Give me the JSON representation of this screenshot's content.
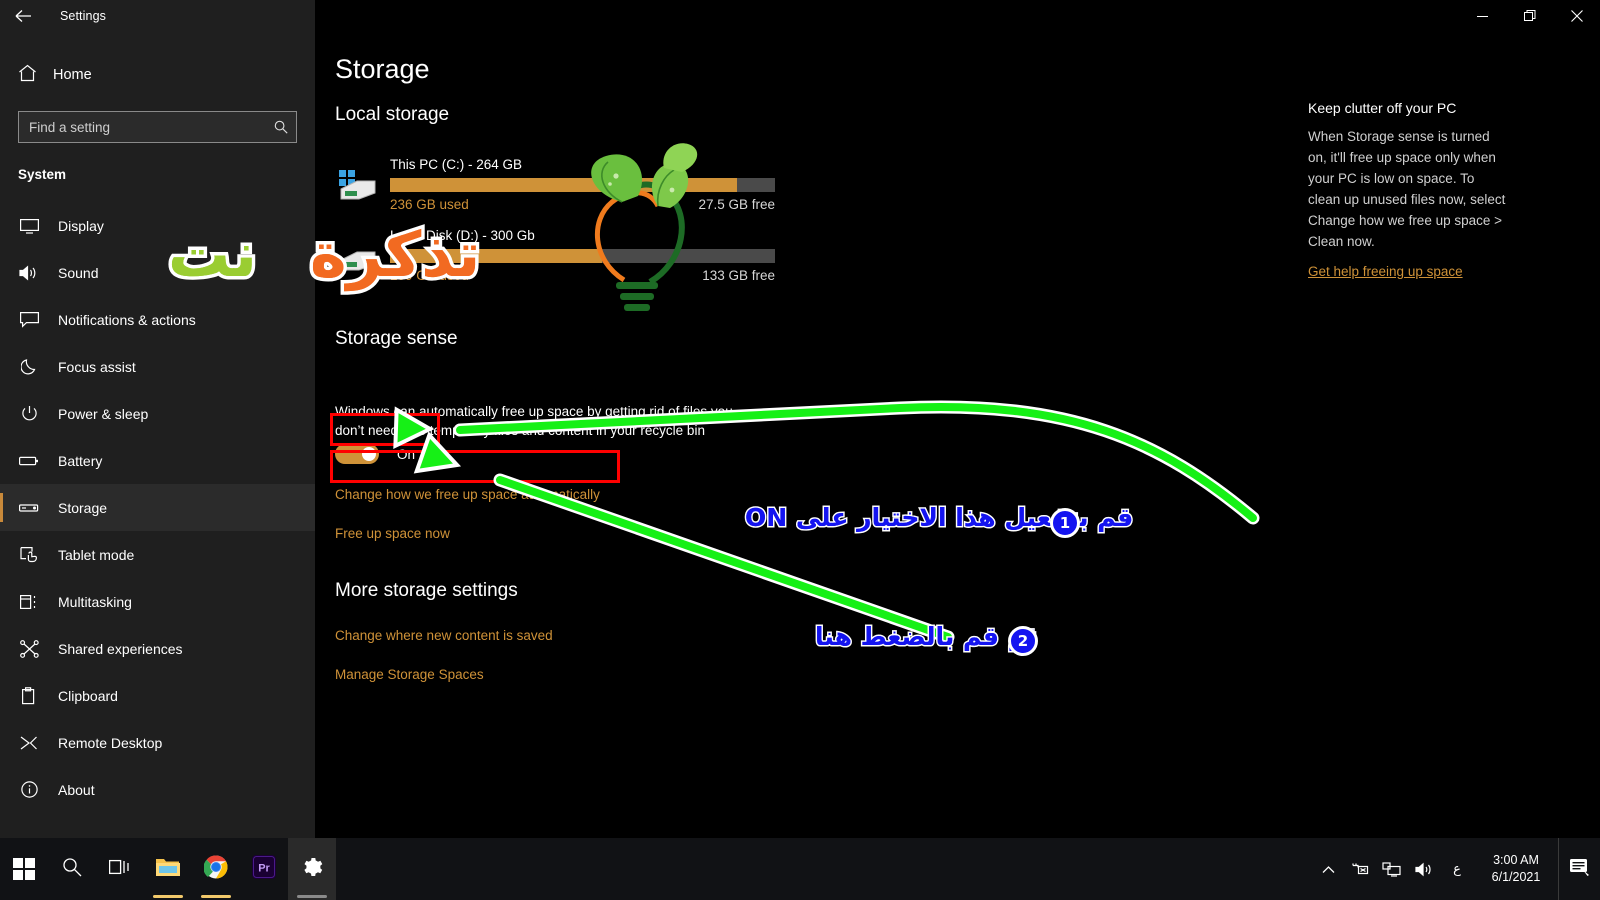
{
  "window": {
    "title": "Settings",
    "back_icon": "back-arrow-icon",
    "minimize_label": "Minimize",
    "restore_label": "Restore",
    "close_label": "Close"
  },
  "sidebar": {
    "home_label": "Home",
    "search": {
      "placeholder": "Find a setting",
      "value": "",
      "icon": "search-icon"
    },
    "section_label": "System",
    "items": [
      {
        "label": "Display",
        "icon": "monitor-icon",
        "selected": false
      },
      {
        "label": "Sound",
        "icon": "speaker-icon",
        "selected": false
      },
      {
        "label": "Notifications & actions",
        "icon": "chat-bubble-icon",
        "selected": false
      },
      {
        "label": "Focus assist",
        "icon": "moon-icon",
        "selected": false
      },
      {
        "label": "Power & sleep",
        "icon": "power-icon",
        "selected": false
      },
      {
        "label": "Battery",
        "icon": "battery-icon",
        "selected": false
      },
      {
        "label": "Storage",
        "icon": "drive-icon",
        "selected": true
      },
      {
        "label": "Tablet mode",
        "icon": "tablet-hand-icon",
        "selected": false
      },
      {
        "label": "Multitasking",
        "icon": "multitask-icon",
        "selected": false
      },
      {
        "label": "Shared experiences",
        "icon": "share-nodes-icon",
        "selected": false
      },
      {
        "label": "Clipboard",
        "icon": "clipboard-icon",
        "selected": false
      },
      {
        "label": "Remote Desktop",
        "icon": "remote-desktop-icon",
        "selected": false
      },
      {
        "label": "About",
        "icon": "info-icon",
        "selected": false
      }
    ]
  },
  "main": {
    "page_title": "Storage",
    "local_storage_heading": "Local storage",
    "drives": [
      {
        "name": "This PC (C:) - 264 GB",
        "used_label": "236 GB used",
        "free_label": "27.5 GB free",
        "fill_percent": 90
      },
      {
        "name": "Local Disk (D:) - 300 Gb",
        "used_label": "159 GB used",
        "free_label": "133 GB free",
        "fill_percent": 55
      }
    ],
    "storage_sense": {
      "heading": "Storage sense",
      "description": "Windows can automatically free up space by getting rid of files you don’t need, like temporary files and content in your recycle bin",
      "toggle_state": "On",
      "toggle_on": true,
      "link_change": "Change how we free up space automatically",
      "link_free_now": "Free up space now"
    },
    "more_settings": {
      "heading": "More storage settings",
      "links": [
        "Change where new content is saved",
        "Manage Storage Spaces"
      ]
    }
  },
  "right_panel": {
    "title": "Keep clutter off your PC",
    "body": "When Storage sense is turned on, it'll free up space only when your PC is low on space. To clean up unused files now, select Change how we free up space > Clean now.",
    "link": "Get help freeing up space"
  },
  "annotations": {
    "step1": {
      "badge": "1",
      "text": "قم بتفعيل هذا الاختيار على ON"
    },
    "step2": {
      "badge": "2",
      "text": "ثم قم بالضغط هنا"
    },
    "highlight_color": "#ff0000",
    "arrow_color": "#16f016",
    "text_color": "#1414f0"
  },
  "watermark": {
    "word_green": "نت",
    "word_orange": "تذكرة",
    "green": "#9acd32",
    "orange": "#f26a21",
    "pink": "#e6007e"
  },
  "taskbar": {
    "items": [
      {
        "name": "start-button",
        "icon": "windows-logo-icon"
      },
      {
        "name": "search-button",
        "icon": "search-icon"
      },
      {
        "name": "task-view-button",
        "icon": "task-view-icon"
      },
      {
        "name": "file-explorer-button",
        "icon": "folder-icon"
      },
      {
        "name": "chrome-button",
        "icon": "chrome-icon"
      },
      {
        "name": "premiere-button",
        "icon": "premiere-pro-icon",
        "label": "Pr"
      },
      {
        "name": "settings-button",
        "icon": "gear-icon"
      }
    ],
    "tray": {
      "chevron": "show-hidden-icons",
      "network": "network-icon",
      "display": "display-icon",
      "volume": "volume-icon",
      "language": "ع",
      "time": "3:00 AM",
      "date": "6/1/2021",
      "notifications": "action-center-icon"
    }
  }
}
